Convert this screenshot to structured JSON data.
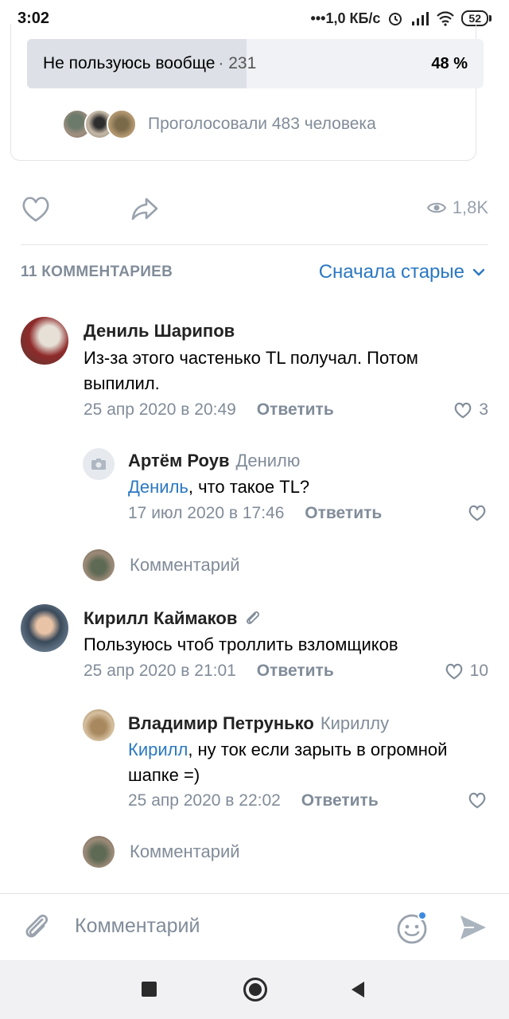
{
  "status_bar": {
    "time": "3:02",
    "network_speed": "•••1,0 КБ/с",
    "battery": "52"
  },
  "poll": {
    "option_label": "Не пользуюсь вообще",
    "option_count": "· 231",
    "option_percent": "48 %",
    "option_fill_fraction": 0.48,
    "voters_text": "Проголосовали 483 человека"
  },
  "post_actions": {
    "views": "1,8K"
  },
  "comments_header": {
    "count_label": "11 КОММЕНТАРИЕВ",
    "sort_label": "Сначала старые"
  },
  "comments": [
    {
      "author": "Дениль Шарипов",
      "text": "Из-за этого частенько TL получал. Потом выпилил.",
      "date": "25 апр 2020 в 20:49",
      "reply_label": "Ответить",
      "likes": "3"
    },
    {
      "author": "Артём Роув",
      "reply_to": "Денилю",
      "mention": "Дениль",
      "text": ", что такое TL?",
      "date": "17 июл 2020 в 17:46",
      "reply_label": "Ответить",
      "likes": ""
    },
    {
      "placeholder": "Комментарий"
    },
    {
      "author": "Кирилл Каймаков",
      "text": "Пользуюсь чтоб троллить взломщиков",
      "date": "25 апр 2020 в 21:01",
      "reply_label": "Ответить",
      "likes": "10"
    },
    {
      "author": "Владимир Петрунько",
      "reply_to": "Кириллу",
      "mention": "Кирилл",
      "text": ", ну ток если зарыть в огромной шапке =)",
      "date": "25 апр 2020 в 22:02",
      "reply_label": "Ответить",
      "likes": ""
    },
    {
      "placeholder": "Комментарий"
    }
  ],
  "composer": {
    "placeholder": "Комментарий"
  },
  "colors": {
    "accent": "#2a78c2",
    "secondary_text": "#818c99",
    "poll_fill": "#dde1e7"
  },
  "icons": [
    "heart-icon",
    "share-icon",
    "eye-icon",
    "chevron-down-icon",
    "camera-icon",
    "paperclip-icon",
    "emoji-icon",
    "send-icon"
  ]
}
